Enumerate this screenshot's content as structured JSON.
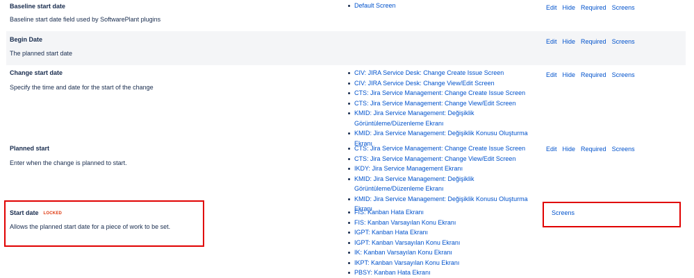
{
  "fields": [
    {
      "name": "Baseline start date",
      "description": "Baseline start date field used by SoftwarePlant plugins",
      "screens": [
        "Default Screen"
      ],
      "operations": [
        "Edit",
        "Hide",
        "Required",
        "Screens"
      ]
    },
    {
      "name": "Begin Date",
      "description": "The planned start date",
      "screens": [],
      "operations": [
        "Edit",
        "Hide",
        "Required",
        "Screens"
      ]
    },
    {
      "name": "Change start date",
      "description": "Specify the time and date for the start of the change",
      "screens": [
        "CIV: JIRA Service Desk: Change Create Issue Screen",
        "CIV: JIRA Service Desk: Change View/Edit Screen",
        "CTS: Jira Service Management: Change Create Issue Screen",
        "CTS: Jira Service Management: Change View/Edit Screen",
        "KMID: Jira Service Management: Değişiklik Görüntüleme/Düzenleme Ekranı",
        "KMID: Jira Service Management: Değişiklik Konusu Oluşturma Ekranı"
      ],
      "operations": [
        "Edit",
        "Hide",
        "Required",
        "Screens"
      ]
    },
    {
      "name": "Planned start",
      "description": "Enter when the change is planned to start.",
      "screens": [
        "CTS: Jira Service Management: Change Create Issue Screen",
        "CTS: Jira Service Management: Change View/Edit Screen",
        "IKDY: Jira Service Management Ekranı",
        "KMID: Jira Service Management: Değişiklik Görüntüleme/Düzenleme Ekranı",
        "KMID: Jira Service Management: Değişiklik Konusu Oluşturma Ekranı"
      ],
      "operations": [
        "Edit",
        "Hide",
        "Required",
        "Screens"
      ]
    },
    {
      "name": "Start date",
      "badge": "LOCKED",
      "description": "Allows the planned start date for a piece of work to be set.",
      "screens": [
        "FIS: Kanban Hata Ekranı",
        "FIS: Kanban Varsayılan Konu Ekranı",
        "IGPT: Kanban Hata Ekranı",
        "IGPT: Kanban Varsayılan Konu Ekranı",
        "IK: Kanban Varsayılan Konu Ekranı",
        "IKPT: Kanban Varsayılan Konu Ekranı",
        "PBSY: Kanban Hata Ekranı"
      ],
      "operations": [
        "Screens"
      ]
    }
  ],
  "colors": {
    "link": "#0052cc",
    "text": "#172b4d",
    "alt_row": "#f4f5f7",
    "locked": "#de350b",
    "highlight": "#e00000"
  }
}
